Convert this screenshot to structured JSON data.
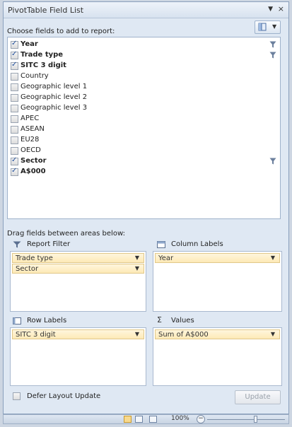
{
  "panel": {
    "title": "PivotTable Field List",
    "choose_label": "Choose fields to add to report:",
    "drag_label": "Drag fields between areas below:"
  },
  "fields": [
    {
      "label": "Year",
      "checked": true,
      "filtered": true
    },
    {
      "label": "Trade type",
      "checked": true,
      "filtered": true
    },
    {
      "label": "SITC 3 digit",
      "checked": true,
      "filtered": false
    },
    {
      "label": "Country",
      "checked": false,
      "filtered": false
    },
    {
      "label": "Geographic level 1",
      "checked": false,
      "filtered": false
    },
    {
      "label": "Geographic level 2",
      "checked": false,
      "filtered": false
    },
    {
      "label": "Geographic level 3",
      "checked": false,
      "filtered": false
    },
    {
      "label": "APEC",
      "checked": false,
      "filtered": false
    },
    {
      "label": "ASEAN",
      "checked": false,
      "filtered": false
    },
    {
      "label": "EU28",
      "checked": false,
      "filtered": false
    },
    {
      "label": "OECD",
      "checked": false,
      "filtered": false
    },
    {
      "label": "Sector",
      "checked": true,
      "filtered": true
    },
    {
      "label": "A$000",
      "checked": true,
      "filtered": false
    }
  ],
  "areas": {
    "report_filter": {
      "label": "Report Filter",
      "items": [
        "Trade type",
        "Sector"
      ]
    },
    "column_labels": {
      "label": "Column Labels",
      "items": [
        "Year"
      ]
    },
    "row_labels": {
      "label": "Row Labels",
      "items": [
        "SITC 3 digit"
      ]
    },
    "values": {
      "label": "Values",
      "items": [
        "Sum of A$000"
      ]
    }
  },
  "footer": {
    "defer_label": "Defer Layout Update",
    "update_label": "Update"
  },
  "statusbar": {
    "zoom": "100%"
  },
  "colors": {
    "pill_fill": "#fde9b6",
    "check_blue": "#1f4e9b"
  }
}
